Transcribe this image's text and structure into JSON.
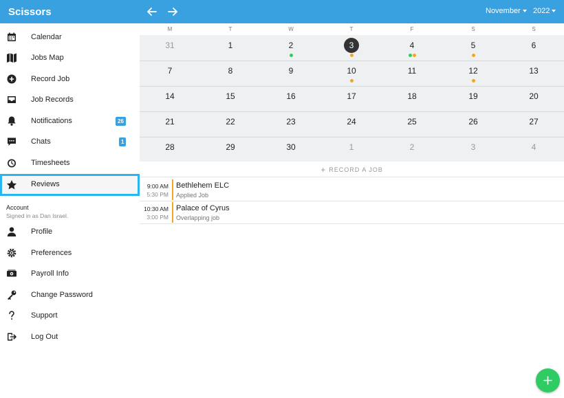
{
  "app": {
    "title": "Scissors",
    "brand_color": "#3aa1e0",
    "accent_color": "#2ecc63"
  },
  "header": {
    "month": "November",
    "year": "2022",
    "back_icon": "arrow-left-icon",
    "forward_icon": "arrow-right-icon"
  },
  "sidebar": {
    "items": [
      {
        "label": "Calendar",
        "icon": "calendar-icon"
      },
      {
        "label": "Jobs Map",
        "icon": "map-icon"
      },
      {
        "label": "Record Job",
        "icon": "plus-circle-icon"
      },
      {
        "label": "Job Records",
        "icon": "inbox-icon"
      },
      {
        "label": "Notifications",
        "icon": "bell-icon",
        "badge": "26"
      },
      {
        "label": "Chats",
        "icon": "chat-icon",
        "badge": "1"
      },
      {
        "label": "Timesheets",
        "icon": "stopwatch-icon"
      },
      {
        "label": "Reviews",
        "icon": "star-icon",
        "selected": true
      }
    ],
    "account": {
      "heading": "Account",
      "signed_in": "Signed in as Dan Israel."
    },
    "account_items": [
      {
        "label": "Profile",
        "icon": "user-icon"
      },
      {
        "label": "Preferences",
        "icon": "gear-icon"
      },
      {
        "label": "Payroll Info",
        "icon": "money-icon"
      },
      {
        "label": "Change Password",
        "icon": "key-icon"
      },
      {
        "label": "Support",
        "icon": "question-icon"
      },
      {
        "label": "Log Out",
        "icon": "logout-icon"
      }
    ]
  },
  "calendar": {
    "weekdays": [
      "M",
      "T",
      "W",
      "T",
      "F",
      "S",
      "S"
    ],
    "weeks": [
      [
        {
          "d": "31",
          "muted": true
        },
        {
          "d": "1"
        },
        {
          "d": "2",
          "dots": [
            "green"
          ]
        },
        {
          "d": "3",
          "today": true,
          "dots": [
            "orange"
          ]
        },
        {
          "d": "4",
          "dots": [
            "green",
            "orange"
          ]
        },
        {
          "d": "5",
          "dots": [
            "orange"
          ]
        },
        {
          "d": "6"
        }
      ],
      [
        {
          "d": "7"
        },
        {
          "d": "8"
        },
        {
          "d": "9"
        },
        {
          "d": "10",
          "dots": [
            "orange"
          ]
        },
        {
          "d": "11"
        },
        {
          "d": "12",
          "dots": [
            "orange"
          ]
        },
        {
          "d": "13"
        }
      ],
      [
        {
          "d": "14"
        },
        {
          "d": "15"
        },
        {
          "d": "16"
        },
        {
          "d": "17"
        },
        {
          "d": "18"
        },
        {
          "d": "19"
        },
        {
          "d": "20"
        }
      ],
      [
        {
          "d": "21"
        },
        {
          "d": "22"
        },
        {
          "d": "23"
        },
        {
          "d": "24"
        },
        {
          "d": "25"
        },
        {
          "d": "26"
        },
        {
          "d": "27"
        }
      ],
      [
        {
          "d": "28"
        },
        {
          "d": "29"
        },
        {
          "d": "30"
        },
        {
          "d": "1",
          "muted": true
        },
        {
          "d": "2",
          "muted": true
        },
        {
          "d": "3",
          "muted": true
        },
        {
          "d": "4",
          "muted": true
        }
      ]
    ],
    "dot_colors": {
      "green": "#2ecc63",
      "orange": "#f3a81c"
    },
    "record_label": "RECORD A JOB"
  },
  "jobs": [
    {
      "start": "9:00 AM",
      "end": "5:30 PM",
      "title": "Bethlehem ELC",
      "status": "Applied Job"
    },
    {
      "start": "10:30 AM",
      "end": "3:00 PM",
      "title": "Palace of Cyrus",
      "status": "Overlapping job"
    }
  ],
  "fab": {
    "icon": "plus-icon"
  }
}
